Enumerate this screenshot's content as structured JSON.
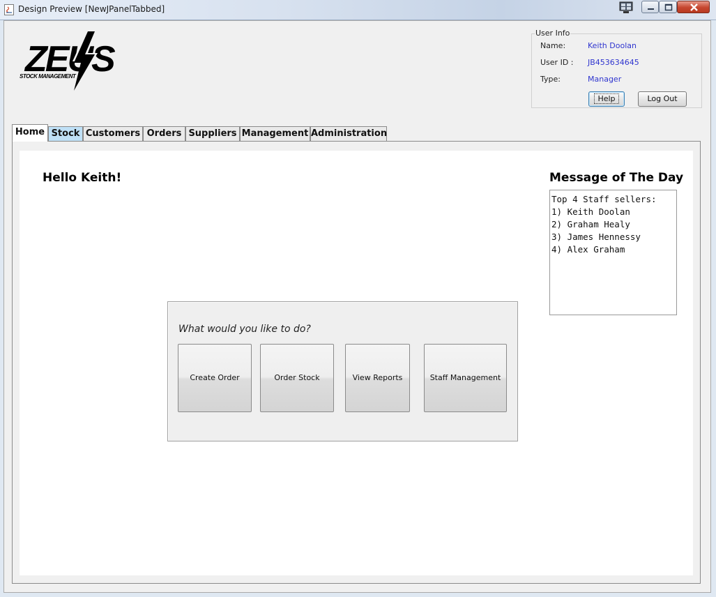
{
  "window": {
    "title": "Design Preview [NewJPanelTabbed]"
  },
  "logo": {
    "text_main": "ZEUS",
    "text_sub": "STOCK MANAGEMENT"
  },
  "user_info": {
    "legend": "User Info",
    "name_label": "Name:",
    "name_value": "Keith Doolan",
    "userid_label": "User ID :",
    "userid_value": "JB453634645",
    "type_label": "Type:",
    "type_value": "Manager",
    "help_label": "Help",
    "logout_label": "Log Out"
  },
  "tabs": [
    {
      "label": "Home",
      "selected": true
    },
    {
      "label": "Stock"
    },
    {
      "label": "Customers"
    },
    {
      "label": "Orders"
    },
    {
      "label": "Suppliers"
    },
    {
      "label": "Management"
    },
    {
      "label": "Administration"
    }
  ],
  "home": {
    "greeting": "Hello Keith!",
    "motd_title": "Message of The Day",
    "motd_lines": [
      "Top 4 Staff sellers:",
      "1) Keith Doolan",
      "2) Graham Healy",
      "3) James Hennessy",
      "4) Alex Graham"
    ],
    "prompt": "What would you like to do?",
    "actions": [
      {
        "label": "Create Order"
      },
      {
        "label": "Order Stock"
      },
      {
        "label": "View Reports"
      },
      {
        "label": "Staff Management"
      }
    ]
  },
  "colors": {
    "value_text": "#2f35cf",
    "stock_tab_highlight": "#bfe0f6"
  }
}
